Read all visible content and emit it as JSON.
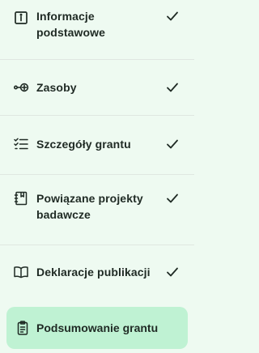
{
  "steps": [
    {
      "label": "Informacje podstawowe",
      "icon": "info-icon",
      "status": "completed",
      "status_icon": "check-icon"
    },
    {
      "label": "Zasoby",
      "icon": "resources-icon",
      "status": "completed",
      "status_icon": "check-icon"
    },
    {
      "label": "Szczegóły grantu",
      "icon": "checklist-icon",
      "status": "completed",
      "status_icon": "check-icon"
    },
    {
      "label": "Powiązane projekty badawcze",
      "icon": "notebook-icon",
      "status": "completed",
      "status_icon": "check-icon"
    },
    {
      "label": "Deklaracje publikacji",
      "icon": "book-icon",
      "status": "completed",
      "status_icon": "check-icon"
    },
    {
      "label": "Podsumowanie grantu",
      "icon": "clipboard-icon",
      "status": "active"
    }
  ],
  "colors": {
    "background": "#eefaf1",
    "active_background": "#bff2d3",
    "divider": "#dfe7e1",
    "text": "#1f2a24"
  }
}
